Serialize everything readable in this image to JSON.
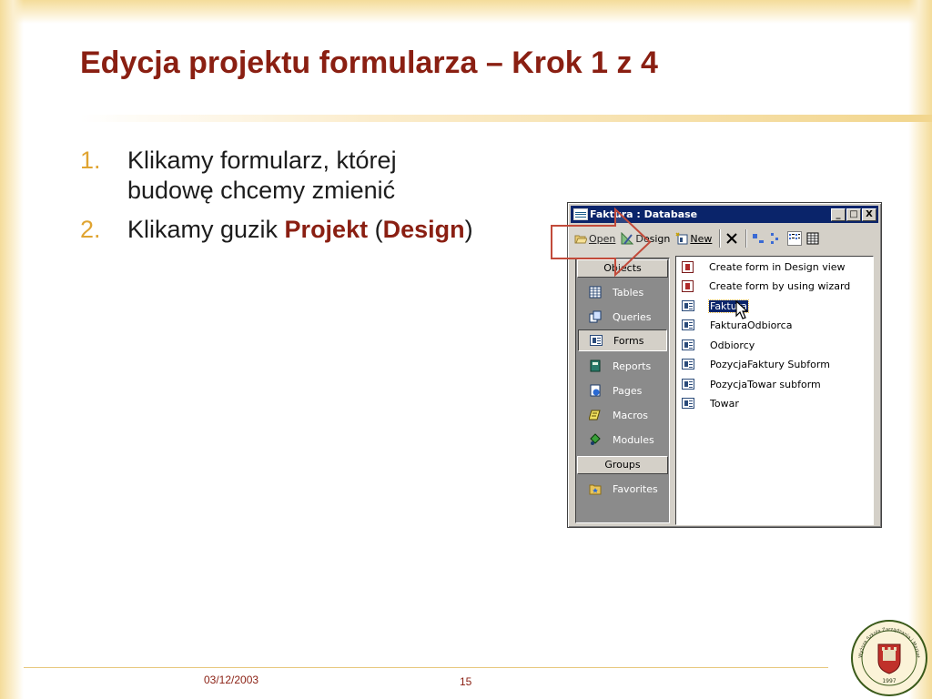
{
  "slide": {
    "title": "Edycja projektu formularza – Krok 1 z 4",
    "bullets": [
      {
        "num": "1.",
        "line1": "Klikamy formularz, której",
        "line2": "budowę chcemy zmienić"
      },
      {
        "num": "2.",
        "prefix": "Klikamy guzik ",
        "bold1": "Projekt",
        "mid": " (",
        "bold2": "Design",
        "suffix": ")"
      }
    ],
    "footer": {
      "date": "03/12/2003",
      "page": "15"
    },
    "logo": {
      "text": "Wyższa Szkoła Zarządzania i Marketingu w Sochaczewie",
      "year": "1997"
    }
  },
  "window": {
    "title": "Faktura : Database",
    "buttons": {
      "minimize": "_",
      "maximize": "□",
      "close": "X"
    },
    "toolbar": {
      "open_label": "Open",
      "design_label": "Design",
      "new_label": "New"
    },
    "sidebar": {
      "objects_header": "Objects",
      "items": [
        {
          "label": "Tables",
          "icon": "table-icon"
        },
        {
          "label": "Queries",
          "icon": "query-icon"
        },
        {
          "label": "Forms",
          "icon": "form-icon",
          "selected": true
        },
        {
          "label": "Reports",
          "icon": "report-icon"
        },
        {
          "label": "Pages",
          "icon": "page-icon"
        },
        {
          "label": "Macros",
          "icon": "macro-icon"
        },
        {
          "label": "Modules",
          "icon": "module-icon"
        }
      ],
      "groups_header": "Groups",
      "group_items": [
        {
          "label": "Favorites",
          "icon": "favorites-folder-icon"
        }
      ]
    },
    "list": [
      {
        "label": "Create form in Design view",
        "icon": "wizard-icon"
      },
      {
        "label": "Create form by using wizard",
        "icon": "wizard-icon"
      },
      {
        "label": "Faktura",
        "icon": "form-icon",
        "selected": true
      },
      {
        "label": "FakturaOdbiorca",
        "icon": "form-icon"
      },
      {
        "label": "Odbiorcy",
        "icon": "form-icon"
      },
      {
        "label": "PozycjaFaktury Subform",
        "icon": "form-icon"
      },
      {
        "label": "PozycjaTowar subform",
        "icon": "form-icon"
      },
      {
        "label": "Towar",
        "icon": "form-icon"
      }
    ]
  },
  "colors": {
    "title": "#8a1f12",
    "bullet_number": "#e0a431",
    "selection": "#0a246a",
    "frame": "#f4dc9a"
  }
}
